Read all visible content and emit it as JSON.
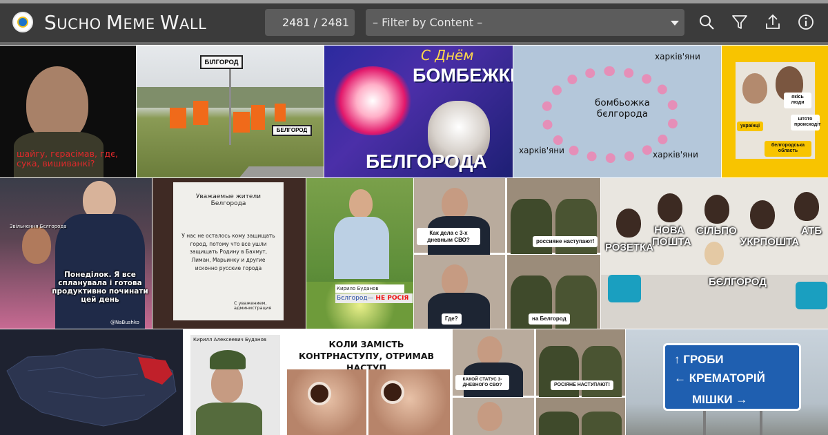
{
  "header": {
    "title_big_1": "S",
    "title_small_1": "UCHO ",
    "title_big_2": "M",
    "title_small_2": "EME ",
    "title_big_3": "W",
    "title_small_3": "ALL",
    "counter": "2481 / 2481",
    "filter_placeholder": "– Filter by Content –",
    "icons": [
      "logo-icon",
      "search-icon",
      "filter-icon",
      "upload-icon",
      "info-icon"
    ]
  },
  "memes": {
    "m1": {
      "caption": "шайгу, гєрасімав, гдє, сука, вишиванкі?"
    },
    "m2": {
      "sign_top": "БІЛГОРОД",
      "sign_bottom": "БЕЛГОРОД"
    },
    "m3": {
      "greeting": "С Днём",
      "word1": "БОМБЕЖКИ",
      "word2": "БЕЛГОРОДА"
    },
    "m4": {
      "center": "бомбьожка бєлгорода",
      "tag": "харків'яни"
    },
    "m5": {
      "bubble1": "якісь люди",
      "bubble2": "штото происходіт",
      "left": "українці",
      "bottom": "белгородська область"
    },
    "m6": {
      "top": "Звільнення Бєлгорода",
      "caption": "Понеділок. Я все спланувала і готова продуктивно починати цей день",
      "credit": "@NaBushko"
    },
    "m7": {
      "title": "Уважаемые жители Белгорода",
      "body": "У нас не осталось кому защищать город, потому что все ушли защищать Родину в Бахмут, Лиман, Марьинку и другие исконно русские города",
      "sign": "С уважением, администрация"
    },
    "m8": {
      "name": "Кирило Буданов",
      "sub_left": "Бєлгород— ",
      "sub_right": "НЕ РОСІЯ"
    },
    "m9": {
      "q1": "Как дела с 3-х дневным СВО?",
      "a1": "россияне наступают!",
      "q2": "Где?",
      "a2": "на Белгород"
    },
    "m10": {
      "l1": "РОЗЕТКА",
      "l2": "НОВА ПОШТА",
      "l3": "СІЛЬПО",
      "l4": "УКРПОШТА",
      "l5": "АТБ",
      "center": "БЄЛГОРОД"
    },
    "m12": {
      "name": "Кирилл Алексеевич Буданов",
      "headline": "КОЛИ ЗАМІСТЬ КОНТРНАСТУПУ, ОТРИМАВ НАСТУП"
    },
    "m13": {
      "q1": "КАКОЙ СТАТУС 3-ДНЕВНОГО СВО?",
      "a1": "РОСІЯНЕ НАСТУПАЮТ!"
    },
    "m14": {
      "r1": "ГРОБИ",
      "r2": "КРЕМАТОРІЙ",
      "r3": "МІШКИ"
    }
  }
}
